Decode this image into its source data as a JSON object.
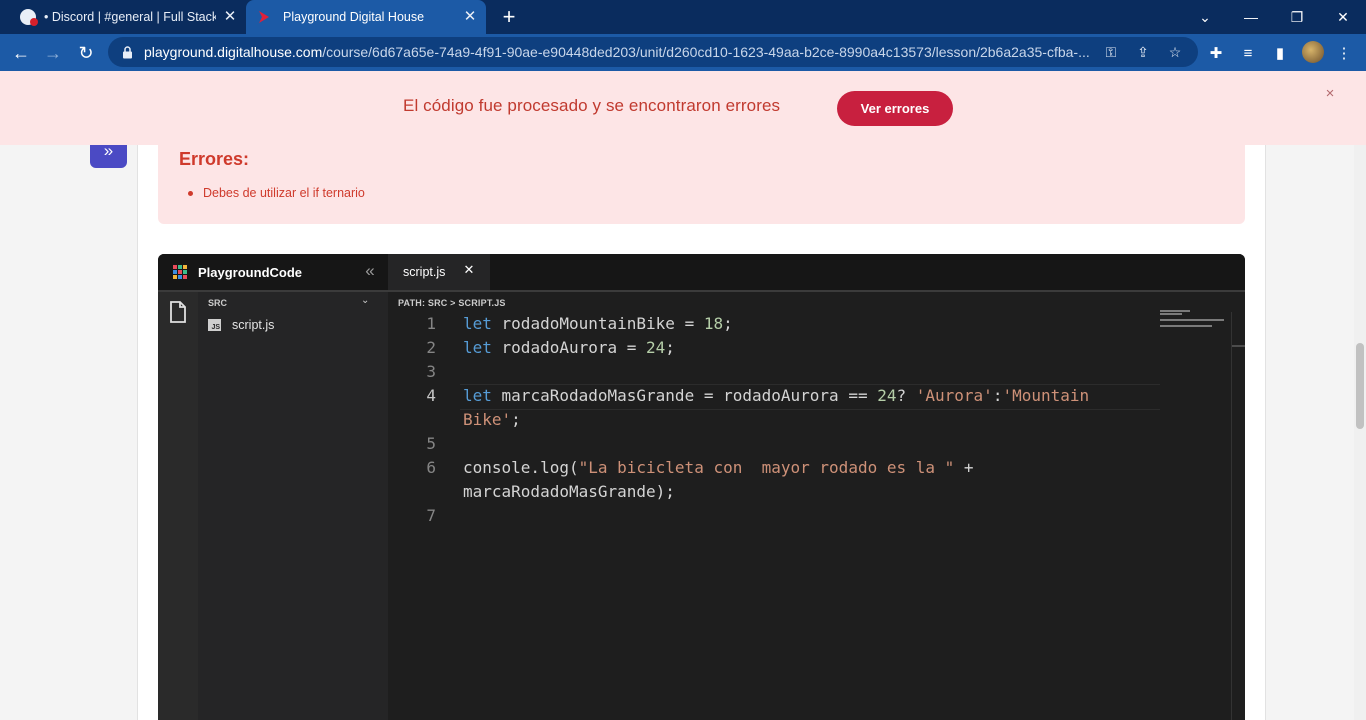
{
  "browser": {
    "tabs": [
      {
        "title": "• Discord | #general | Full Stack N",
        "active": false
      },
      {
        "title": "Playground Digital House",
        "active": true
      }
    ],
    "url_host": "playground.digitalhouse.com",
    "url_path": "/course/6d67a65e-74a9-4f91-90ae-e90448ded203/unit/d260cd10-1623-49aa-b2ce-8990a4c13573/lesson/2b6a2a35-cfba-..."
  },
  "banner": {
    "message": "El código fue procesado y se encontraron errores",
    "button_label": "Ver errores",
    "close_glyph": "×"
  },
  "errors": {
    "title": "Errores:",
    "items": [
      "Debes de utilizar el if ternario"
    ]
  },
  "playground": {
    "brand": "PlaygroundCode",
    "tab_label": "script.js",
    "explorer_folder": "SRC",
    "explorer_file": "script.js",
    "path": "PATH: SRC > SCRIPT.JS",
    "current_line": 4
  },
  "colors": {
    "browser_frame": "#0a2c5e",
    "browser_toolbar": "#1c5aa6",
    "error_bg": "#fde5e6",
    "error_text": "#cf3a2c",
    "accent_button": "#c8203f",
    "expand_button": "#4b4ac4",
    "editor_bg": "#1e1e1e",
    "keyword": "#569cd6",
    "number": "#b5cea8",
    "string": "#ce9178"
  }
}
